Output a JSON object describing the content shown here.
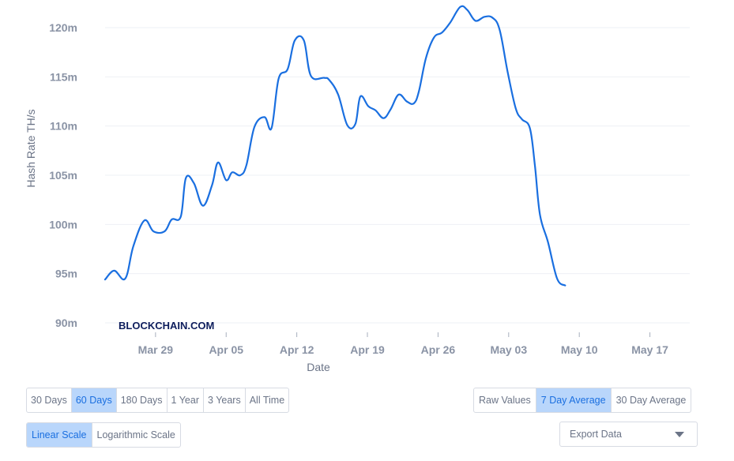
{
  "chart_data": {
    "type": "line",
    "xlabel": "Date",
    "ylabel": "Hash Rate TH/s",
    "watermark": "BLOCKCHAIN.COM",
    "ylim": [
      89,
      122
    ],
    "yticks": [
      {
        "value": 90,
        "label": "90m"
      },
      {
        "value": 95,
        "label": "95m"
      },
      {
        "value": 100,
        "label": "100m"
      },
      {
        "value": 105,
        "label": "105m"
      },
      {
        "value": 110,
        "label": "110m"
      },
      {
        "value": 115,
        "label": "115m"
      },
      {
        "value": 120,
        "label": "120m"
      }
    ],
    "xticks": [
      {
        "day": 7,
        "label": "Mar 29"
      },
      {
        "day": 14,
        "label": "Apr 05"
      },
      {
        "day": 21,
        "label": "Apr 12"
      },
      {
        "day": 28,
        "label": "Apr 19"
      },
      {
        "day": 35,
        "label": "Apr 26"
      },
      {
        "day": 42,
        "label": "May 03"
      },
      {
        "day": 49,
        "label": "May 10"
      },
      {
        "day": 56,
        "label": "May 17"
      }
    ],
    "xlim": [
      2,
      60
    ],
    "grid": true,
    "line_color": "#1a6fe0",
    "series": [
      {
        "points": [
          [
            2.0,
            94.4
          ],
          [
            2.9,
            95.3
          ],
          [
            4.0,
            94.5
          ],
          [
            4.8,
            97.8
          ],
          [
            5.9,
            100.4
          ],
          [
            6.8,
            99.3
          ],
          [
            7.9,
            99.3
          ],
          [
            8.6,
            100.5
          ],
          [
            9.5,
            100.8
          ],
          [
            10.0,
            104.7
          ],
          [
            10.8,
            104.2
          ],
          [
            11.7,
            101.9
          ],
          [
            12.6,
            104.0
          ],
          [
            13.2,
            106.3
          ],
          [
            14.0,
            104.5
          ],
          [
            14.6,
            105.3
          ],
          [
            15.4,
            105.0
          ],
          [
            16.0,
            106.0
          ],
          [
            16.8,
            109.9
          ],
          [
            17.8,
            110.9
          ],
          [
            18.5,
            109.8
          ],
          [
            19.2,
            114.8
          ],
          [
            20.1,
            115.8
          ],
          [
            20.8,
            118.7
          ],
          [
            21.7,
            118.7
          ],
          [
            22.4,
            115.1
          ],
          [
            23.7,
            114.9
          ],
          [
            24.2,
            114.7
          ],
          [
            25.1,
            113.2
          ],
          [
            26.0,
            110.1
          ],
          [
            26.8,
            110.2
          ],
          [
            27.3,
            113.0
          ],
          [
            28.1,
            112.0
          ],
          [
            28.8,
            111.6
          ],
          [
            29.6,
            110.8
          ],
          [
            30.3,
            111.7
          ],
          [
            31.1,
            113.2
          ],
          [
            31.9,
            112.5
          ],
          [
            32.6,
            112.3
          ],
          [
            33.1,
            113.5
          ],
          [
            33.8,
            116.9
          ],
          [
            34.6,
            119.0
          ],
          [
            35.4,
            119.5
          ],
          [
            36.2,
            120.5
          ],
          [
            37.2,
            122.1
          ],
          [
            37.9,
            121.8
          ],
          [
            38.7,
            120.7
          ],
          [
            39.6,
            121.1
          ],
          [
            40.4,
            121.0
          ],
          [
            41.1,
            119.8
          ],
          [
            41.9,
            115.5
          ],
          [
            42.7,
            111.8
          ],
          [
            43.3,
            110.7
          ],
          [
            44.1,
            109.8
          ],
          [
            44.6,
            106.0
          ],
          [
            45.1,
            101.0
          ],
          [
            45.9,
            98.2
          ],
          [
            46.8,
            94.5
          ],
          [
            47.6,
            93.8
          ]
        ]
      }
    ]
  },
  "controls": {
    "range_buttons": [
      "30 Days",
      "60 Days",
      "180 Days",
      "1 Year",
      "3 Years",
      "All Time"
    ],
    "range_active": "60 Days",
    "average_buttons": [
      "Raw Values",
      "7 Day Average",
      "30 Day Average"
    ],
    "average_active": "7 Day Average",
    "scale_buttons": [
      "Linear Scale",
      "Logarithmic Scale"
    ],
    "scale_active": "Linear Scale",
    "export_label": "Export Data"
  }
}
